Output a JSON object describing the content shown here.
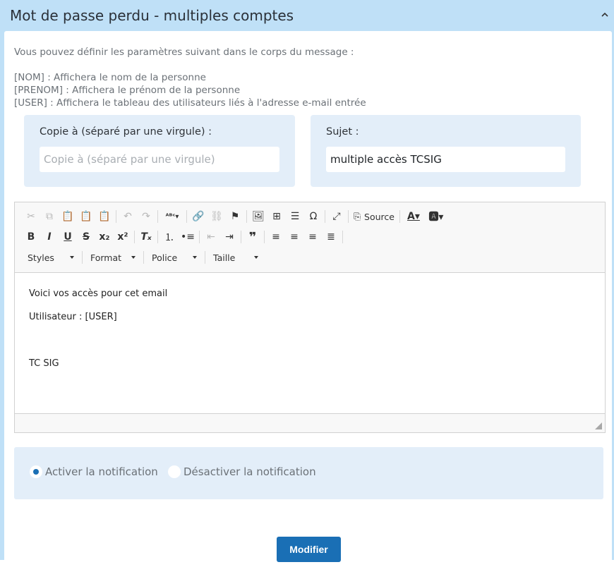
{
  "panel": {
    "title": "Mot de passe perdu - multiples comptes",
    "collapse_icon": "chevron-up-icon"
  },
  "description": {
    "intro": "Vous pouvez définir les paramètres suivant dans le corps du message :",
    "lines": [
      "[NOM] : Affichera le nom de la personne",
      "[PRENOM] : Affichera le prénom de la personne",
      "[USER] : Affichera le tableau des utilisateurs liés à l'adresse e-mail entrée"
    ]
  },
  "copy_field": {
    "label": "Copie à (séparé par une virgule) :",
    "placeholder": "Copie à (séparé par une virgule)",
    "value": ""
  },
  "subject_field": {
    "label": "Sujet :",
    "value": "multiple accès TCSIG"
  },
  "editor": {
    "toolbar": {
      "source_label": "Source",
      "combos": [
        "Styles",
        "Format",
        "Police",
        "Taille"
      ]
    },
    "content": [
      "Voici vos accès pour cet email",
      "Utilisateur : [USER]",
      "TC SIG"
    ]
  },
  "notification": {
    "enable_label": "Activer la notification",
    "disable_label": "Désactiver la notification",
    "selected": "enable"
  },
  "submit_label": "Modifier",
  "colors": {
    "header_bg": "#bfe0f7",
    "field_bg": "#e3eef9",
    "accent": "#1a6fb5"
  }
}
